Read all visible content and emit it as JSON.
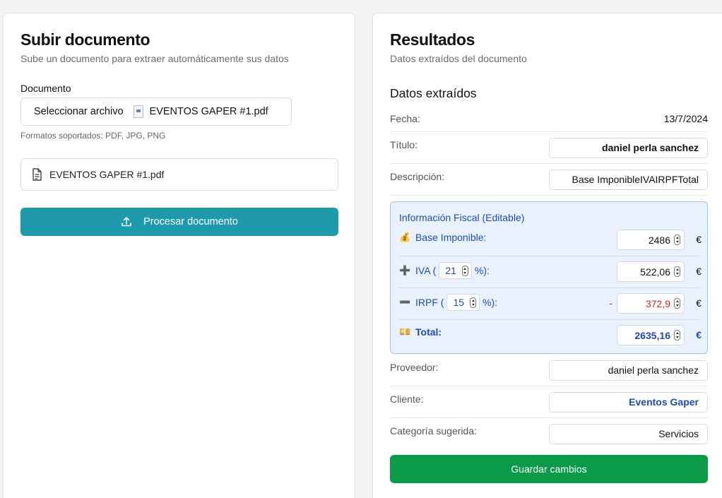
{
  "upload": {
    "title": "Subir documento",
    "subtitle": "Sube un documento para extraer automáticamente sus datos",
    "doc_label": "Documento",
    "picker_button": "Seleccionar archivo",
    "picker_filename": "EVENTOS GAPER #1.pdf",
    "formats": "Formatos soportados: PDF, JPG, PNG",
    "file_item": "EVENTOS GAPER #1.pdf",
    "process_button": "Procesar documento",
    "process_color": "#1e9baa"
  },
  "results": {
    "title": "Resultados",
    "subtitle": "Datos extraídos del documento",
    "section_title": "Datos extraídos",
    "fecha_label": "Fecha:",
    "fecha_value": "13/7/2024",
    "titulo_label": "Título:",
    "titulo_value": "daniel perla sanchez",
    "descripcion_label": "Descripción:",
    "descripcion_value": "Base ImponibleIVAIRPFTotal",
    "fiscal": {
      "title": "Información Fiscal (Editable)",
      "base_label": "Base Imponible:",
      "base_value": "2486",
      "iva_label_pre": "IVA (",
      "iva_pct": "21",
      "iva_label_post": "%):",
      "iva_value": "522,06",
      "irpf_label_pre": "IRPF (",
      "irpf_pct": "15",
      "irpf_label_post": "%):",
      "irpf_sign": "-",
      "irpf_value": "372,9",
      "total_label": "Total:",
      "total_value": "2635,16",
      "currency": "€",
      "icons": [
        "money-bag-icon",
        "plus-icon",
        "minus-icon",
        "money-bill-icon"
      ]
    },
    "proveedor_label": "Proveedor:",
    "proveedor_value": "daniel perla sanchez",
    "cliente_label": "Cliente:",
    "cliente_value": "Eventos Gaper",
    "categoria_label": "Categoría sugerida:",
    "categoria_value": "Servicios",
    "save_button": "Guardar cambios",
    "save_color": "#0a9a4a",
    "accent_blue": "#1d4bb5",
    "negative_red": "#d62828"
  }
}
